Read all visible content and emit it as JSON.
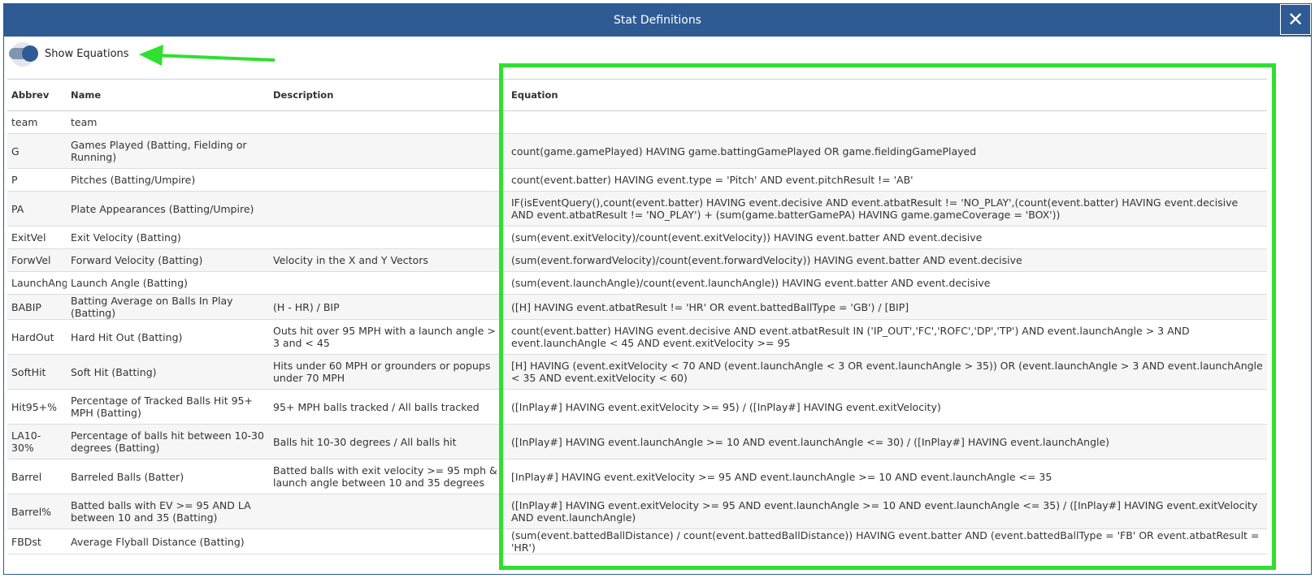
{
  "dialog": {
    "title": "Stat Definitions",
    "close_icon": "✕"
  },
  "toggle": {
    "label": "Show Equations",
    "on": true
  },
  "annotation": {
    "color": "#2fe02f"
  },
  "table": {
    "headers": {
      "abbrev": "Abbrev",
      "name": "Name",
      "description": "Description",
      "equation": "Equation"
    },
    "rows": [
      {
        "abbrev": "team",
        "name": "team",
        "description": "",
        "equation": ""
      },
      {
        "abbrev": "G",
        "name": "Games Played (Batting, Fielding or Running)",
        "description": "",
        "equation": "count(game.gamePlayed) HAVING game.battingGamePlayed OR game.fieldingGamePlayed"
      },
      {
        "abbrev": "P",
        "name": "Pitches (Batting/Umpire)",
        "description": "",
        "equation": "count(event.batter) HAVING event.type = 'Pitch' AND event.pitchResult != 'AB'"
      },
      {
        "abbrev": "PA",
        "name": "Plate Appearances (Batting/Umpire)",
        "description": "",
        "equation": "IF(isEventQuery(),count(event.batter) HAVING event.decisive AND event.atbatResult != 'NO_PLAY',(count(event.batter) HAVING event.decisive AND event.atbatResult != 'NO_PLAY') + (sum(game.batterGamePA) HAVING game.gameCoverage = 'BOX'))"
      },
      {
        "abbrev": "ExitVel",
        "name": "Exit Velocity (Batting)",
        "description": "",
        "equation": "(sum(event.exitVelocity)/count(event.exitVelocity)) HAVING event.batter AND event.decisive"
      },
      {
        "abbrev": "ForwVel",
        "name": "Forward Velocity (Batting)",
        "description": "Velocity in the X and Y Vectors",
        "equation": "(sum(event.forwardVelocity)/count(event.forwardVelocity)) HAVING event.batter AND event.decisive"
      },
      {
        "abbrev": "LaunchAng",
        "name": "Launch Angle (Batting)",
        "description": "",
        "equation": "(sum(event.launchAngle)/count(event.launchAngle)) HAVING event.batter AND event.decisive"
      },
      {
        "abbrev": "BABIP",
        "name": "Batting Average on Balls In Play (Batting)",
        "description": "(H - HR) / BIP",
        "equation": "([H] HAVING event.atbatResult != 'HR' OR event.battedBallType = 'GB') / [BIP]"
      },
      {
        "abbrev": "HardOut",
        "name": "Hard Hit Out (Batting)",
        "description": "Outs hit over 95 MPH with a launch angle > 3 and < 45",
        "equation": "count(event.batter) HAVING event.decisive AND event.atbatResult IN ('IP_OUT','FC','ROFC','DP','TP') AND event.launchAngle > 3 AND event.launchAngle < 45 AND event.exitVelocity >= 95"
      },
      {
        "abbrev": "SoftHit",
        "name": "Soft Hit (Batting)",
        "description": "Hits under 60 MPH or grounders or popups under 70 MPH",
        "equation": "[H] HAVING (event.exitVelocity < 70 AND (event.launchAngle < 3 OR event.launchAngle > 35)) OR (event.launchAngle > 3 AND event.launchAngle < 35 AND event.exitVelocity < 60)"
      },
      {
        "abbrev": "Hit95+%",
        "name": "Percentage of Tracked Balls Hit 95+ MPH (Batting)",
        "description": "95+ MPH balls tracked / All balls tracked",
        "equation": "([InPlay#] HAVING event.exitVelocity >= 95) / ([InPlay#] HAVING event.exitVelocity)"
      },
      {
        "abbrev": "LA10-30%",
        "name": "Percentage of balls hit between 10-30 degrees (Batting)",
        "description": "Balls hit 10-30 degrees / All balls hit",
        "equation": "([InPlay#] HAVING event.launchAngle >= 10 AND event.launchAngle <= 30) / ([InPlay#] HAVING event.launchAngle)"
      },
      {
        "abbrev": "Barrel",
        "name": "Barreled Balls (Batter)",
        "description": "Batted balls with exit velocity >= 95 mph & launch angle between 10 and 35 degrees",
        "equation": "[InPlay#] HAVING event.exitVelocity >= 95 AND event.launchAngle >= 10 AND event.launchAngle <= 35"
      },
      {
        "abbrev": "Barrel%",
        "name": "Batted balls with EV >= 95 AND LA between 10 and 35 (Batting)",
        "description": "",
        "equation": "([InPlay#] HAVING event.exitVelocity >= 95 AND event.launchAngle >= 10 AND event.launchAngle <= 35) / ([InPlay#] HAVING event.exitVelocity AND event.launchAngle)"
      },
      {
        "abbrev": "FBDst",
        "name": "Average Flyball Distance (Batting)",
        "description": "",
        "equation": "(sum(event.battedBallDistance) / count(event.battedBallDistance)) HAVING event.batter AND (event.battedBallType = 'FB' OR event.atbatResult = 'HR')"
      }
    ]
  }
}
